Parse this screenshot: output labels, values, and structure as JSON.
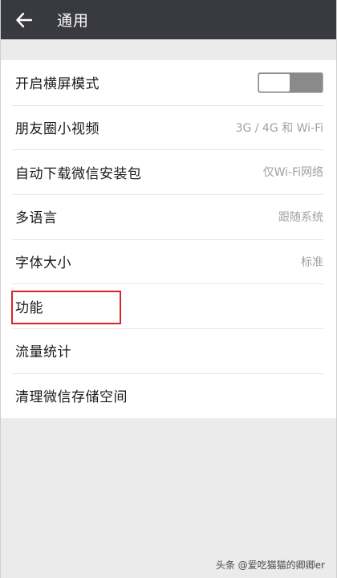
{
  "header": {
    "back_icon": "arrow-left-icon",
    "title": "通用",
    "background_color": "#393a3f"
  },
  "settings": [
    {
      "label": "开启横屏模式",
      "value": "",
      "control": "toggle",
      "toggle_on": false
    },
    {
      "label": "朋友圈小视频",
      "value": "3G / 4G 和 Wi-Fi"
    },
    {
      "label": "自动下载微信安装包",
      "value": "仅Wi-Fi网络"
    },
    {
      "label": "多语言",
      "value": "跟随系统"
    },
    {
      "label": "字体大小",
      "value": "标准"
    },
    {
      "label": "功能",
      "value": ""
    },
    {
      "label": "流量统计",
      "value": ""
    },
    {
      "label": "清理微信存储空间",
      "value": ""
    }
  ],
  "annotation": {
    "highlight_color": "#d9242b",
    "highlighted_item": "功能"
  },
  "watermark": "头条 @爱吃猫猫的卿卿er"
}
